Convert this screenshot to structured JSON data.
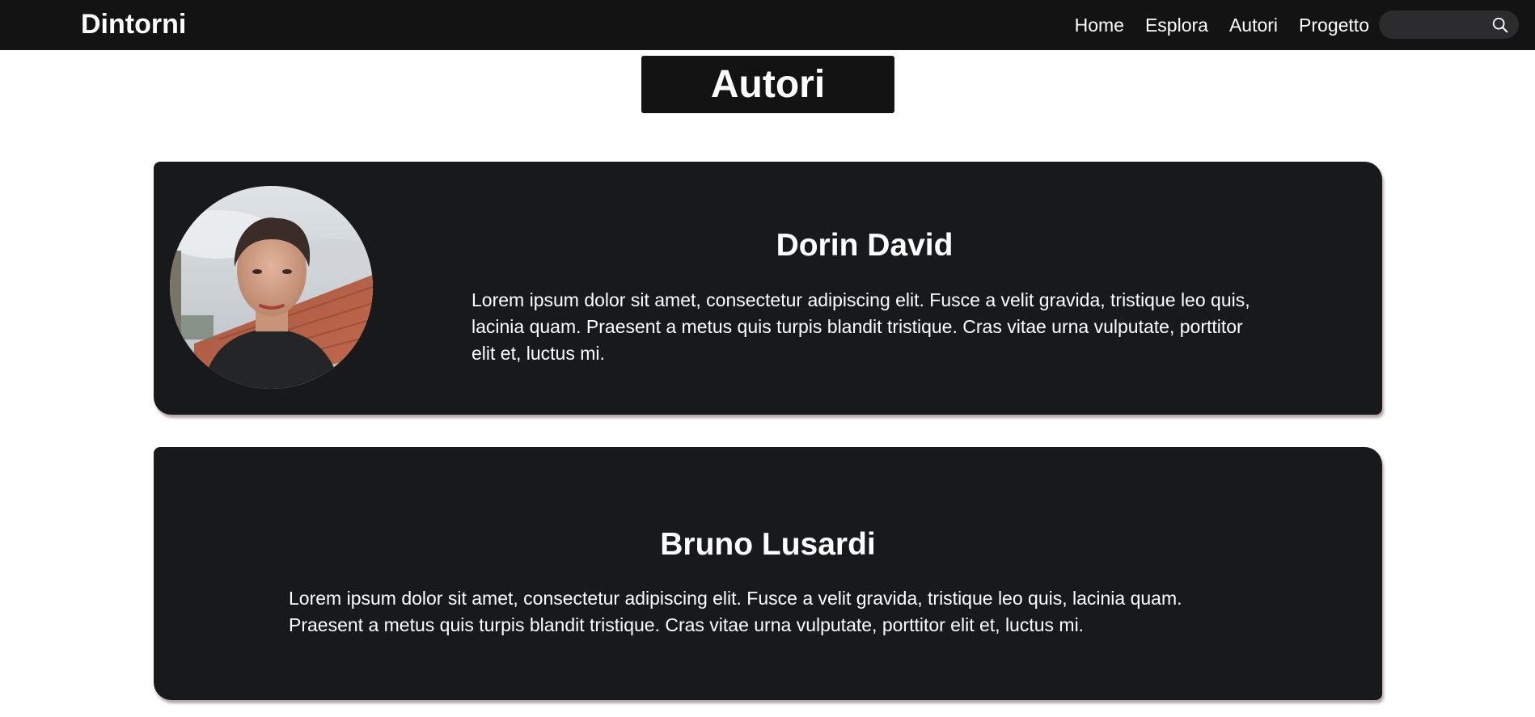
{
  "navbar": {
    "brand": "Dintorni",
    "links": [
      "Home",
      "Esplora",
      "Autori",
      "Progetto"
    ],
    "search": {
      "value": "",
      "placeholder": "",
      "icon": "search-icon"
    }
  },
  "page": {
    "title": "Autori"
  },
  "authors": [
    {
      "name": "Dorin David",
      "bio": "Lorem ipsum dolor sit amet, consectetur adipiscing elit. Fusce a velit gravida, tristique leo quis, lacinia quam. Praesent a metus quis turpis blandit tristique. Cras vitae urna vulputate, porttitor elit et, luctus mi.",
      "has_photo": true
    },
    {
      "name": "Bruno Lusardi",
      "bio": "Lorem ipsum dolor sit amet, consectetur adipiscing elit. Fusce a velit gravida, tristique leo quis, lacinia quam. Praesent a metus quis turpis blandit tristique. Cras vitae urna vulputate, porttitor elit et, luctus mi.",
      "has_photo": false
    }
  ],
  "colors": {
    "navbar_bg": "#131313",
    "card_bg": "#18191b",
    "text": "#ffffff",
    "search_bg": "#2c2c2e"
  }
}
